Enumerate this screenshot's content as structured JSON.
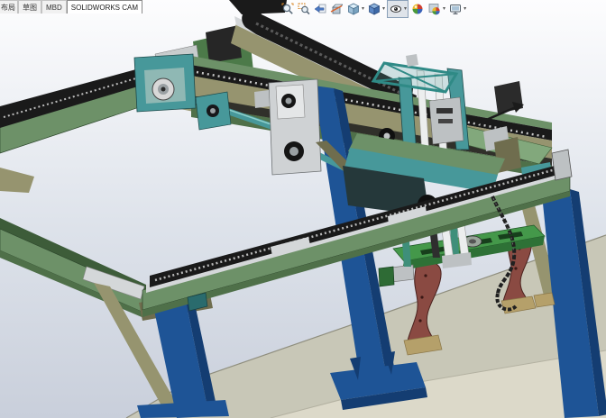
{
  "tabs": {
    "items": [
      {
        "label": "布局",
        "state": "clipped"
      },
      {
        "label": "草图",
        "state": "normal"
      },
      {
        "label": "MBD",
        "state": "normal"
      },
      {
        "label": "SOLIDWORKS CAM",
        "state": "active"
      }
    ]
  },
  "heads_up_toolbar": {
    "buttons": [
      {
        "name": "zoom-to-fit",
        "icon": "magnifier-icon",
        "has_dropdown": false,
        "pressed": false
      },
      {
        "name": "zoom-to-area",
        "icon": "magnifier-area-icon",
        "has_dropdown": false,
        "pressed": false
      },
      {
        "name": "previous-view",
        "icon": "back-arrow-icon",
        "has_dropdown": false,
        "pressed": false
      },
      {
        "name": "section-view",
        "icon": "section-cube-icon",
        "has_dropdown": false,
        "pressed": false
      },
      {
        "name": "view-orientation",
        "icon": "cube-icon",
        "has_dropdown": true,
        "pressed": false
      },
      {
        "name": "display-style",
        "icon": "shaded-cube-icon",
        "has_dropdown": true,
        "pressed": false
      },
      {
        "name": "hide-show-items",
        "icon": "eye-icon",
        "has_dropdown": true,
        "pressed": true
      },
      {
        "name": "edit-appearance",
        "icon": "appearance-ball-icon",
        "has_dropdown": false,
        "pressed": false
      },
      {
        "name": "apply-scene",
        "icon": "scene-ball-icon",
        "has_dropdown": true,
        "pressed": false
      },
      {
        "name": "view-settings",
        "icon": "monitor-icon",
        "has_dropdown": true,
        "pressed": false
      }
    ]
  },
  "scene": {
    "colors": {
      "viewport_top": "#fcfdfe",
      "viewport_bottom": "#c9cfdb",
      "floor_top": "#c8c7b7",
      "floor_front": "#dcd9c9",
      "floor_edge": "#8f8e7e",
      "beam_green": "#6d9168",
      "beam_green_dark": "#4f7049",
      "deck_olive": "#9a9874",
      "beam_olive": "#96946f",
      "beam_olive_dark": "#6f6d4e",
      "rack_black": "#1a1a1a",
      "rail_silver": "#d4d7d9",
      "teal": "#47989a",
      "teal_dark": "#2a6b6d",
      "column_blue": "#1e5496",
      "column_blue_dark": "#143d72",
      "stand_brown": "#8a4a42",
      "fixture_green": "#44984a",
      "fixture_green_dark": "#2e7136",
      "tan": "#b5a06a",
      "white_rod": "#eceeee",
      "gray_metal": "#bdc1c3",
      "gearbox_gray": "#cfd2d4"
    }
  }
}
